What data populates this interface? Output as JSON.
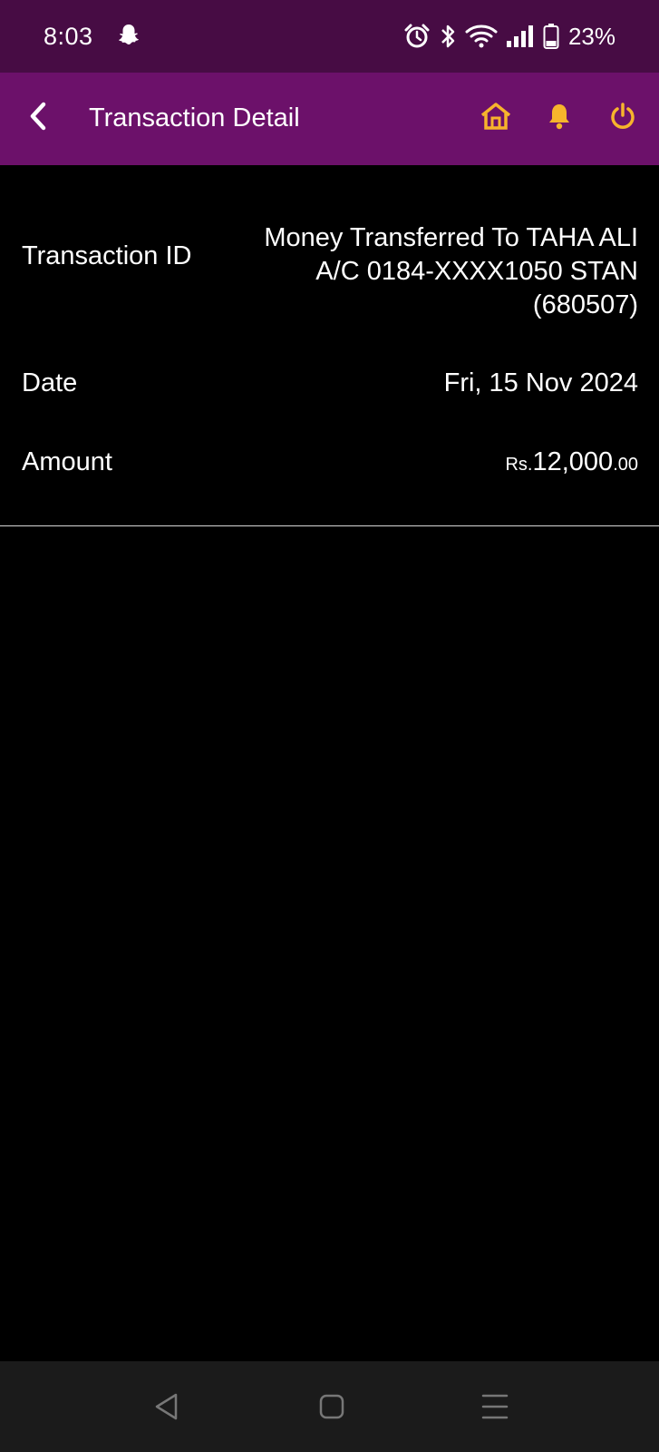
{
  "status_bar": {
    "time": "8:03",
    "battery": "23%",
    "icons": [
      "snapchat-icon",
      "alarm-icon",
      "bluetooth-icon",
      "wifi-icon",
      "signal-icon",
      "battery-icon"
    ]
  },
  "app_bar": {
    "title": "Transaction Detail",
    "background": "#6c116a",
    "icon_color": "#f7b42c",
    "actions": [
      "home-icon",
      "bell-icon",
      "power-icon"
    ]
  },
  "detail": {
    "transaction_id": {
      "label": "Transaction ID",
      "value": "Money Transferred To TAHA ALI A/C 0184-XXXX1050 STAN (680507)"
    },
    "date": {
      "label": "Date",
      "value": "Fri, 15 Nov 2024"
    },
    "amount": {
      "label": "Amount",
      "currency": "Rs.",
      "whole": "12,000",
      "decimal": ".00",
      "color": "#c0282d"
    }
  },
  "nav_bar": {
    "buttons": [
      "back-triangle-icon",
      "home-square-icon",
      "recents-icon"
    ]
  }
}
